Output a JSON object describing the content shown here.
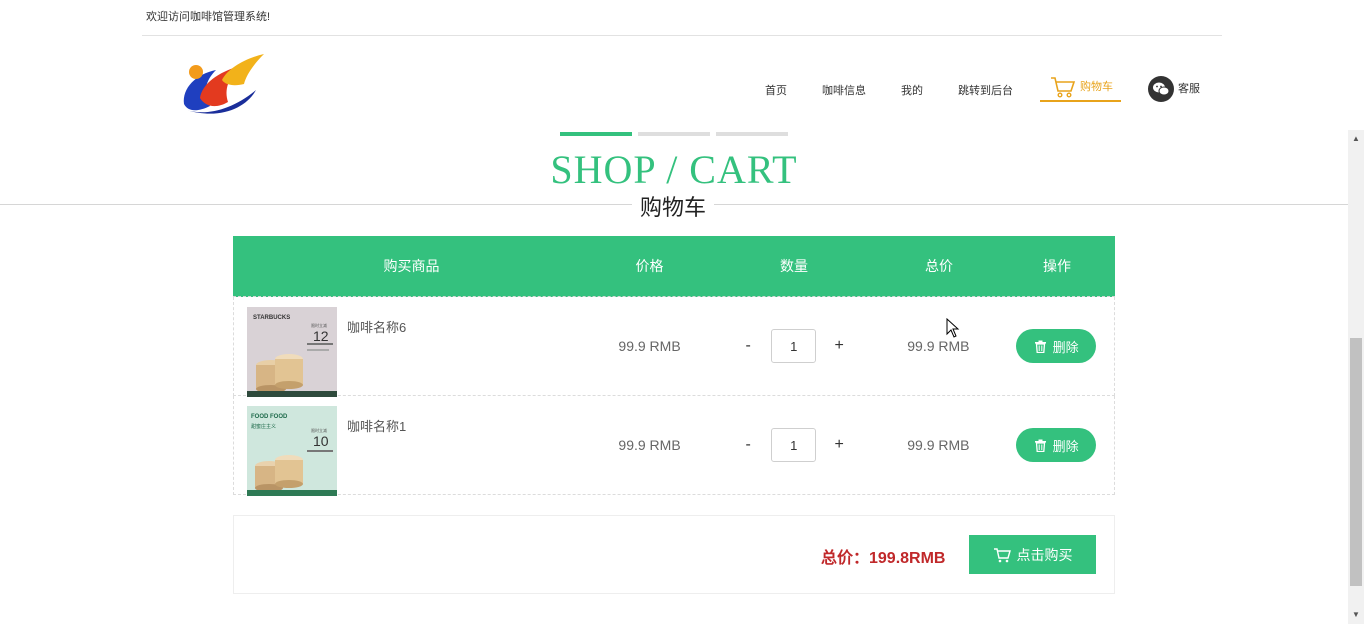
{
  "topbar": {
    "welcome": "欢迎访问咖啡馆管理系统!"
  },
  "nav": {
    "items": [
      {
        "label": "首页"
      },
      {
        "label": "咖啡信息"
      },
      {
        "label": "我的"
      },
      {
        "label": "跳转到后台"
      }
    ],
    "cart_label": "购物车",
    "service_label": "客服"
  },
  "title": {
    "en": "SHOP / CART",
    "cn": "购物车"
  },
  "table": {
    "headers": {
      "goods": "购买商品",
      "price": "价格",
      "qty": "数量",
      "total": "总价",
      "op": "操作"
    },
    "rows": [
      {
        "name": "咖啡名称6",
        "price": "99.9 RMB",
        "minus": "-",
        "qty": "1",
        "plus": "+",
        "total": "99.9 RMB",
        "delete_label": "删除"
      },
      {
        "name": "咖啡名称1",
        "price": "99.9 RMB",
        "minus": "-",
        "qty": "1",
        "plus": "+",
        "total": "99.9 RMB",
        "delete_label": "删除"
      }
    ]
  },
  "thumbs": {
    "1": {
      "brand": "STARBUCKS",
      "tag": "限时立减",
      "price": "12"
    },
    "2": {
      "brand": "FOOD FOOD",
      "sub": "甜蜜庄主义",
      "tag": "限时立减",
      "price": "10"
    }
  },
  "summary": {
    "label": "总价：199.8RMB",
    "buy_label": "点击购买"
  },
  "colors": {
    "accent": "#34c17e",
    "cart_active": "#e8a31b",
    "total_red": "#c0282a"
  }
}
